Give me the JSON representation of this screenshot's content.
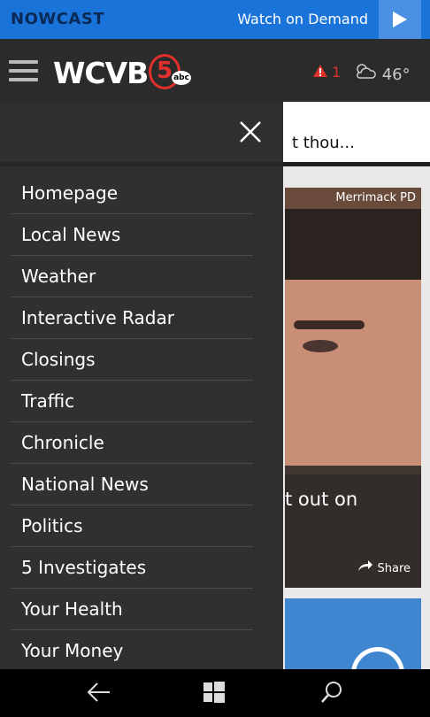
{
  "topbar": {
    "nowcast": "NOWCAST",
    "watch": "Watch on Demand"
  },
  "header": {
    "logo": "WCVB",
    "channel": "5",
    "network": "abc",
    "alert_count": "1",
    "temperature": "46°"
  },
  "background": {
    "breaking_text": "t thou...",
    "card_source": "Merrimack PD",
    "card_headline": "t out on",
    "share": "Share"
  },
  "menu": {
    "items": [
      "Homepage",
      "Local News",
      "Weather",
      "Interactive Radar",
      "Closings",
      "Traffic",
      "Chronicle",
      "National News",
      "Politics",
      "5 Investigates",
      "Your Health",
      "Your Money"
    ]
  },
  "colors": {
    "brand_blue": "#1a73d9",
    "alert_red": "#e0302b"
  }
}
